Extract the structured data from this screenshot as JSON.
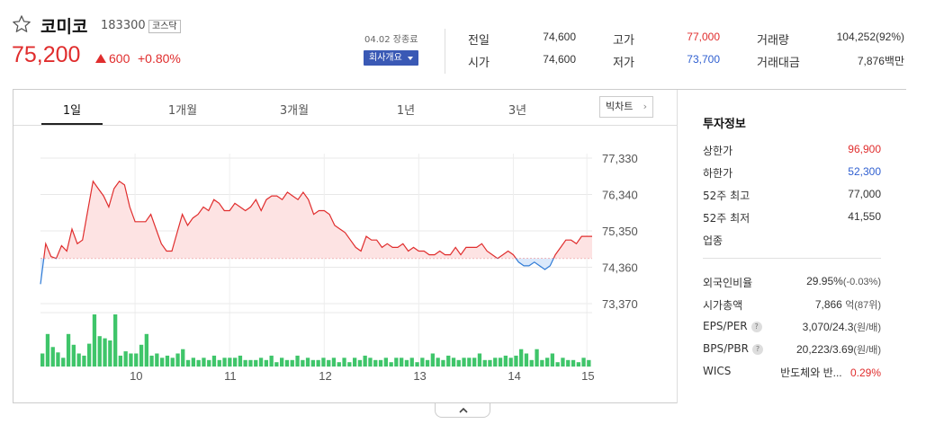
{
  "stock": {
    "name": "코미코",
    "code": "183300",
    "market": "코스닥",
    "price": "75,200",
    "change": "600",
    "change_pct": "+0.80%",
    "date": "04.02 장종료",
    "company_button": "회사개요"
  },
  "quotes": {
    "prev_close_label": "전일",
    "prev_close": "74,600",
    "open_label": "시가",
    "open": "74,600",
    "high_label": "고가",
    "high": "77,000",
    "low_label": "저가",
    "low": "73,700",
    "volume_label": "거래량",
    "volume": "104,252(92%)",
    "amount_label": "거래대금",
    "amount": "7,876백만"
  },
  "tabs": [
    "1일",
    "1개월",
    "3개월",
    "1년",
    "3년"
  ],
  "big_chart_label": "빅차트",
  "chart_data": {
    "type": "area",
    "title": "",
    "y_ticks": [
      "77,330",
      "76,340",
      "75,350",
      "74,360",
      "73,370"
    ],
    "x_ticks": [
      "10",
      "11",
      "12",
      "13",
      "14",
      "15"
    ],
    "ylim": [
      73370,
      77330
    ],
    "baseline": 74600,
    "price_series": [
      73900,
      75000,
      74650,
      74600,
      74950,
      74800,
      75400,
      75000,
      75100,
      75900,
      76700,
      76500,
      76300,
      76000,
      76500,
      76700,
      76600,
      76000,
      75600,
      75600,
      75600,
      75800,
      75400,
      75000,
      74800,
      74800,
      75300,
      75800,
      75500,
      75700,
      75800,
      76000,
      75900,
      76200,
      76100,
      75900,
      75900,
      76100,
      76000,
      75900,
      76000,
      76200,
      75900,
      76200,
      76300,
      76300,
      76200,
      76400,
      76300,
      76200,
      76400,
      76200,
      75800,
      75900,
      75900,
      75800,
      75500,
      75400,
      75300,
      75100,
      74900,
      74800,
      75200,
      75100,
      75100,
      74900,
      75000,
      74900,
      74900,
      75000,
      74800,
      74900,
      74800,
      74800,
      74700,
      74700,
      74800,
      74700,
      74700,
      74900,
      74700,
      74900,
      74900,
      74900,
      75000,
      74800,
      74700,
      74600,
      74700,
      74800,
      74700,
      74500,
      74400,
      74400,
      74500,
      74400,
      74300,
      74400,
      74700,
      74900,
      75100,
      75100,
      75000,
      75200,
      75200,
      75200
    ],
    "volume_series": [
      12,
      30,
      18,
      13,
      8,
      30,
      20,
      12,
      10,
      21,
      48,
      28,
      26,
      24,
      48,
      10,
      14,
      12,
      12,
      20,
      30,
      10,
      12,
      8,
      10,
      8,
      12,
      16,
      6,
      8,
      6,
      8,
      6,
      10,
      6,
      8,
      8,
      8,
      10,
      6,
      6,
      6,
      8,
      6,
      10,
      4,
      8,
      6,
      6,
      10,
      6,
      8,
      6,
      6,
      8,
      6,
      8,
      4,
      8,
      4,
      8,
      6,
      10,
      8,
      6,
      6,
      8,
      4,
      8,
      8,
      6,
      8,
      4,
      8,
      6,
      12,
      8,
      6,
      10,
      8,
      6,
      8,
      8,
      8,
      12,
      6,
      6,
      8,
      8,
      10,
      8,
      10,
      16,
      12,
      6,
      16,
      6,
      8,
      12,
      4,
      8,
      6,
      6,
      4,
      8,
      6
    ],
    "colors": {
      "up": "#e02d2d",
      "down": "#2f7bd6",
      "volume": "#3fc56a",
      "fill_up": "#fde3e3",
      "fill_down": "#dbe9fb"
    }
  },
  "invest_info": {
    "title": "투자정보",
    "upper_limit_label": "상한가",
    "upper_limit": "96,900",
    "lower_limit_label": "하한가",
    "lower_limit": "52,300",
    "w52_high_label": "52주 최고",
    "w52_high": "77,000",
    "w52_low_label": "52주 최저",
    "w52_low": "41,550",
    "industry_label": "업종",
    "foreign_label": "외국인비율",
    "foreign": "29.95%",
    "foreign_chg": "(-0.03%)",
    "mktcap_label": "시가총액",
    "mktcap": "7,866",
    "mktcap_unit": "억(87위)",
    "eps_label": "EPS/PER",
    "eps": "3,070/24.3",
    "eps_unit": "(원/배)",
    "bps_label": "BPS/PBR",
    "bps": "20,223/3.69",
    "bps_unit": "(원/배)",
    "wics_label": "WICS",
    "wics": "반도체와 반...",
    "wics_chg": "0.29%",
    "help_mark": "?"
  }
}
